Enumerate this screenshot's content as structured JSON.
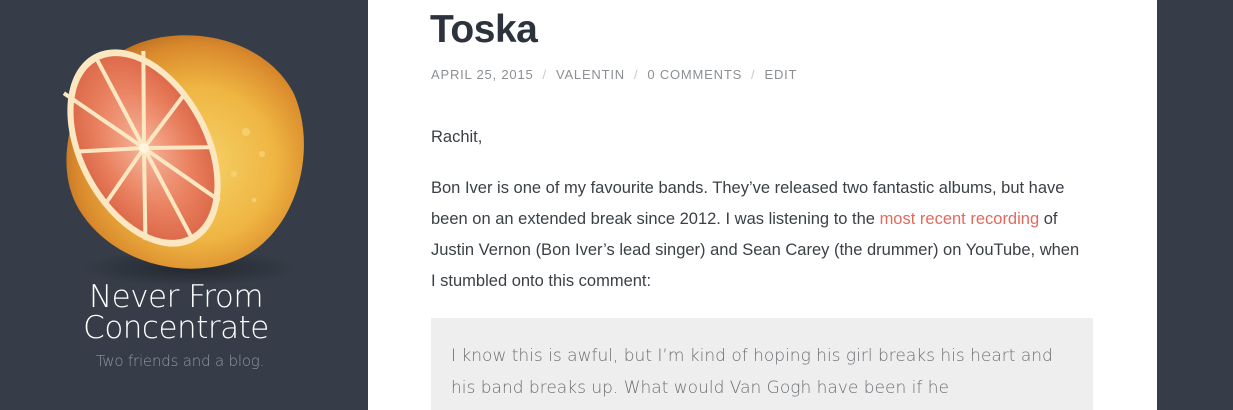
{
  "site": {
    "title_line1": "Never From",
    "title_line2": "Concentrate",
    "tagline": "Two friends and a blog.",
    "logo_icon": "grapefruit-half-icon"
  },
  "post": {
    "title": "Toska",
    "meta": {
      "date": "APRIL 25, 2015",
      "author": "VALENTIN",
      "comments": "0 COMMENTS",
      "edit": "EDIT",
      "separator": "/"
    },
    "salutation": "Rachit,",
    "paragraph": {
      "part1": "Bon Iver is one of my favourite bands. They’ve released two fantastic albums, but have been on an extended break since 2012. I was listening to the ",
      "link": "most recent recording",
      "part2": " of Justin Vernon (Bon Iver’s lead singer) and Sean Carey (the drummer) on YouTube, when I stumbled onto this comment:"
    },
    "quote": "I know this is awful, but I’m kind of hoping his girl breaks his heart and his band breaks up. What would Van Gogh have been if he"
  },
  "colors": {
    "sidebar_bg": "#363d48",
    "content_bg": "#ffffff",
    "link": "#e6685c",
    "title": "#2c333d",
    "meta": "#8b8f93",
    "quote_bg": "#eeeeee"
  }
}
